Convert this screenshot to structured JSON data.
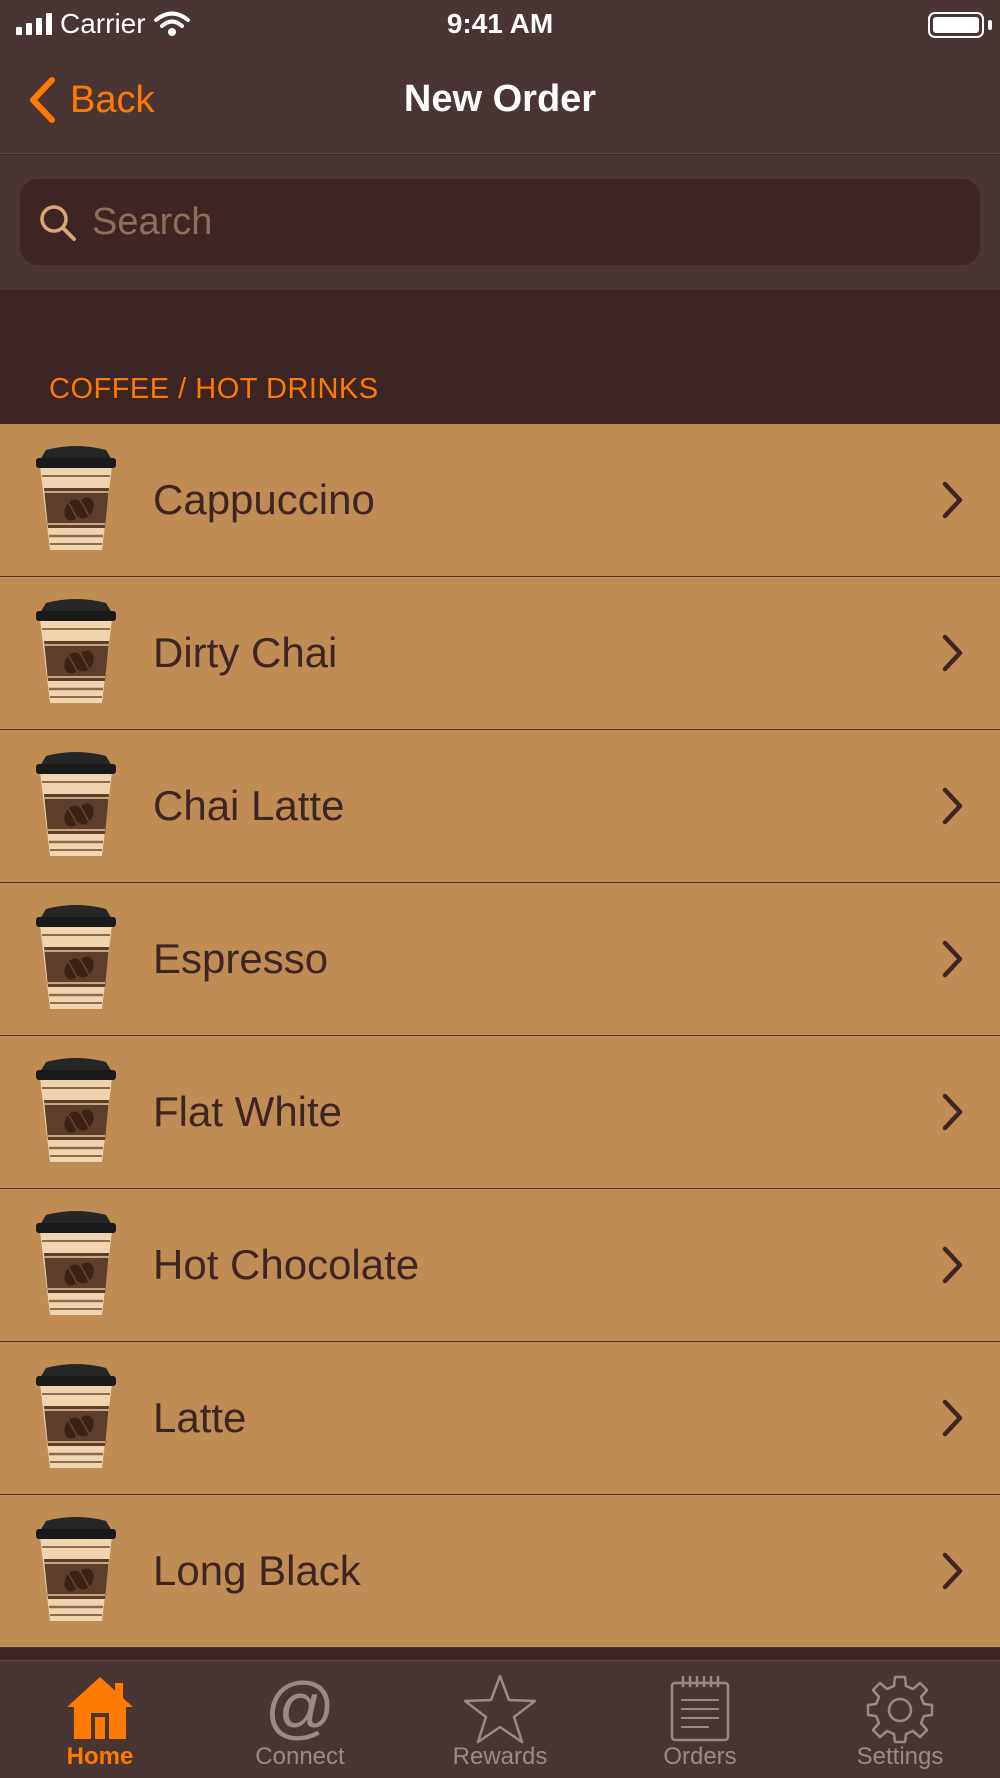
{
  "status_bar": {
    "carrier": "Carrier",
    "time": "9:41 AM"
  },
  "nav": {
    "back_label": "Back",
    "title": "New Order"
  },
  "search": {
    "placeholder": "Search",
    "value": ""
  },
  "section": {
    "title": "COFFEE / HOT DRINKS"
  },
  "items": [
    {
      "name": "Cappuccino"
    },
    {
      "name": "Dirty Chai"
    },
    {
      "name": "Chai Latte"
    },
    {
      "name": "Espresso"
    },
    {
      "name": "Flat White"
    },
    {
      "name": "Hot Chocolate"
    },
    {
      "name": "Latte"
    },
    {
      "name": "Long Black"
    }
  ],
  "tabs": [
    {
      "label": "Home",
      "icon": "home-icon",
      "active": true
    },
    {
      "label": "Connect",
      "icon": "at-icon",
      "active": false
    },
    {
      "label": "Rewards",
      "icon": "star-icon",
      "active": false
    },
    {
      "label": "Orders",
      "icon": "notepad-icon",
      "active": false
    },
    {
      "label": "Settings",
      "icon": "gear-icon",
      "active": false
    }
  ],
  "colors": {
    "accent": "#ff7a00",
    "bar_background": "#4a3535",
    "dark_background": "#3c2522",
    "row_background": "#bf8d54",
    "row_text": "#3c2522",
    "inactive_tab": "#9a8a87"
  }
}
